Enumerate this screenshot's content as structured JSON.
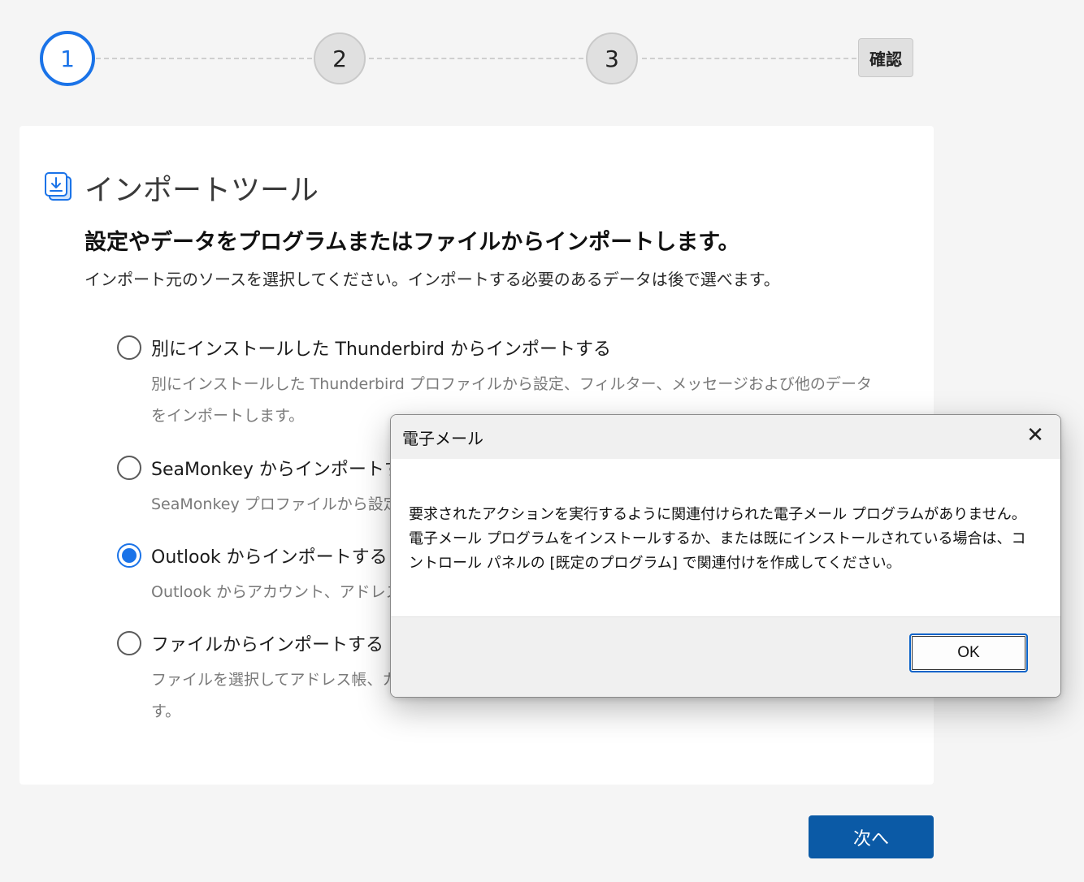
{
  "stepper": {
    "steps": [
      {
        "label": "1",
        "state": "active"
      },
      {
        "label": "2",
        "state": "inactive"
      },
      {
        "label": "3",
        "state": "inactive"
      }
    ],
    "confirm_label": "確認"
  },
  "card": {
    "title": "インポートツール",
    "heading": "設定やデータをプログラムまたはファイルからインポートします。",
    "subtext": "インポート元のソースを選択してください。インポートする必要のあるデータは後で選べます。",
    "options": [
      {
        "label": "別にインストールした Thunderbird からインポートする",
        "description": "別にインストールした Thunderbird プロファイルから設定、フィルター、メッセージおよび他のデータをインポートします。",
        "checked": false
      },
      {
        "label": "SeaMonkey からインポートする",
        "description": "SeaMonkey プロファイルから設定",
        "checked": false
      },
      {
        "label": "Outlook からインポートする",
        "description": "Outlook からアカウント、アドレス帳",
        "checked": true
      },
      {
        "label": "ファイルからインポートする",
        "description": "ファイルを選択してアドレス帳、カレ\nす。",
        "checked": false
      }
    ]
  },
  "next_button_label": "次へ",
  "dialog": {
    "title": "電子メール",
    "close_icon": "close-icon",
    "message": "要求されたアクションを実行するように関連付けられた電子メール プログラムがありません。電子メール プログラムをインストールするか、または既にインストールされている場合は、コントロール パネルの [既定のプログラム] で関連付けを作成してください。",
    "ok_label": "OK"
  },
  "colors": {
    "accent": "#1a73e8",
    "primary_button": "#0b5aa6",
    "background": "#f5f5f5"
  }
}
